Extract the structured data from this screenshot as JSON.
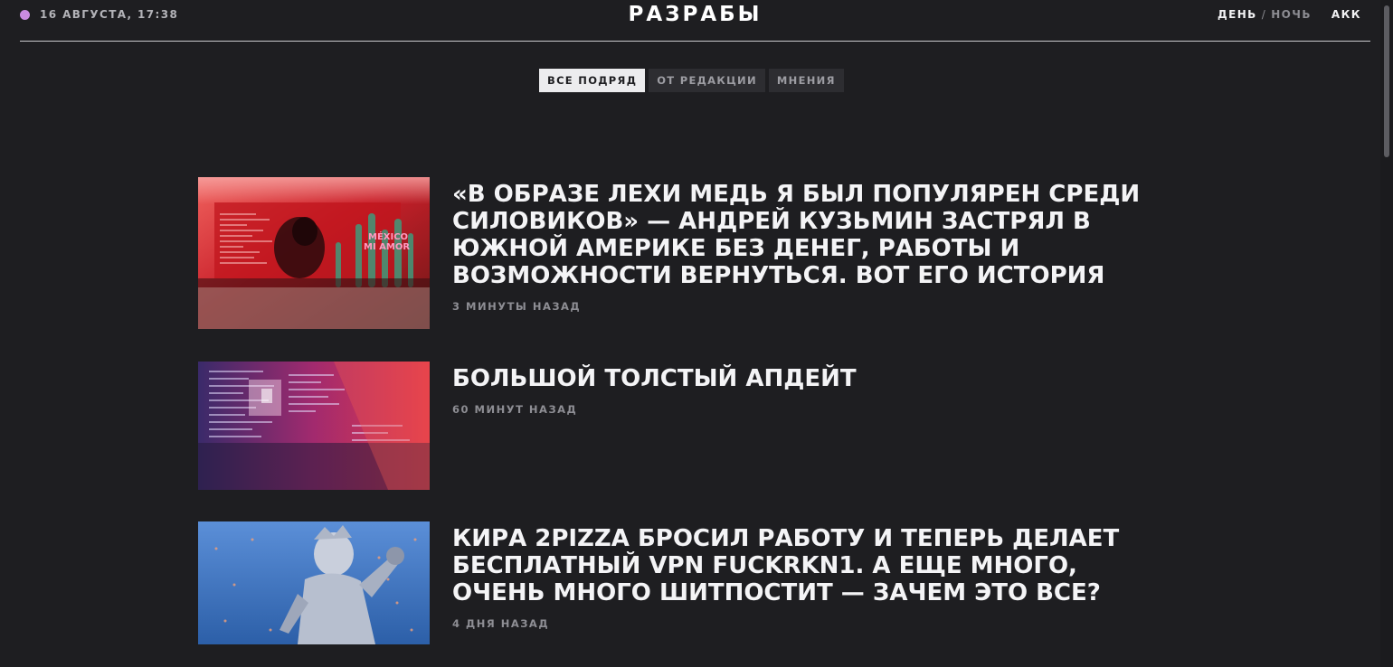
{
  "header": {
    "datetime": "16 АВГУСТА, 17:38",
    "logo": "РАЗРАБЫ",
    "theme_day": "ДЕНЬ",
    "theme_separator": "/",
    "theme_night": "НОЧЬ",
    "account": "АКК",
    "status_dot_color": "#c98be0"
  },
  "tabs": [
    {
      "label": "ВСЕ ПОДРЯД",
      "active": true
    },
    {
      "label": "ОТ РЕДАКЦИИ",
      "active": false
    },
    {
      "label": "МНЕНИЯ",
      "active": false
    }
  ],
  "articles": [
    {
      "title": "«В ОБРАЗЕ ЛЕХИ МЕДЬ Я БЫЛ ПОПУЛЯРЕН СРЕДИ СИЛОВИКОВ» — АНДРЕЙ КУЗЬМИН ЗАСТРЯЛ В ЮЖНОЙ АМЕРИКЕ БЕЗ ДЕНЕГ, РАБОТЫ И ВОЗМОЖНОСТИ ВЕРНУТЬСЯ. ВОТ ЕГО ИСТОРИЯ",
      "time": "3 МИНУТЫ НАЗАД",
      "image_text_1": "MÉXICO",
      "image_text_2": "MI AMOR"
    },
    {
      "title": "БОЛЬШОЙ ТОЛСТЫЙ АПДЕЙТ",
      "time": "60 МИНУТ НАЗАД"
    },
    {
      "title": "КИРА 2PIZZA БРОСИЛ РАБОТУ И ТЕПЕРЬ ДЕЛАЕТ БЕСПЛАТНЫЙ VPN FUCKRKN1. А ЕЩЕ МНОГО, ОЧЕНЬ МНОГО ШИТПОСТИТ — ЗАЧЕМ ЭТО ВСЕ?",
      "time": "4 ДНЯ НАЗАД"
    }
  ],
  "colors": {
    "background": "#1e1e21",
    "text": "#f4f4f6",
    "muted": "#8e8e94",
    "tab_active_bg": "#ececee",
    "tab_bg": "#2d2d31"
  }
}
